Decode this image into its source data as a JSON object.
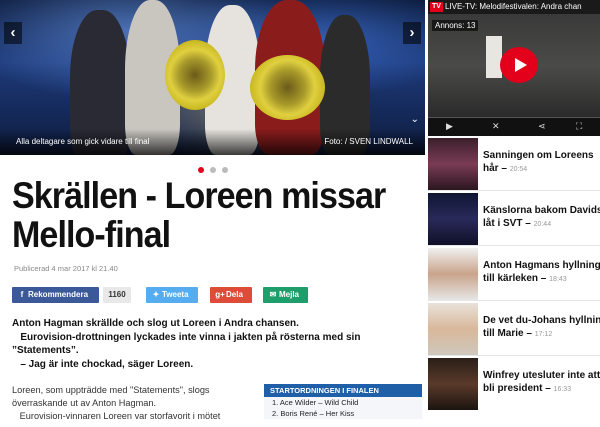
{
  "hero": {
    "caption": "Alla deltagare som gick vidare till final",
    "credit": "Foto: / SVEN LINDWALL",
    "prev": "‹",
    "next": "›",
    "expand": "⌄"
  },
  "article": {
    "headline": "Skrällen - Loreen missar Mello-final",
    "published": "Publicerad 4 mar 2017 kl 21.40",
    "share": {
      "facebook_label": "Rekommendera",
      "facebook_count": "1160",
      "twitter_label": "Tweeta",
      "gplus_label": "Dela",
      "email_label": "Mejla"
    },
    "lead": [
      "Anton Hagman skrällde och slog ut Loreen i Andra chansen.",
      "   Eurovision-drottningen lyckades inte vinna i jakten på rösterna med sin ”Statements”.",
      "   – Jag är inte chockad, säger Loreen."
    ],
    "body": [
      "Loreen, som uppträdde med \"Statements\", slogs överraskande ut av Anton Hagman.",
      "   Eurovision-vinnaren Loreen var storfavorit i mötet"
    ],
    "box": {
      "heading": "STARTORDNINGEN I FINALEN",
      "items": [
        "1. Ace Wilder – Wild Child",
        "2. Boris René – Her Kiss"
      ]
    }
  },
  "video": {
    "tv_badge": "TV",
    "title": "LIVE-TV: Melodifestivalen: Andra chan",
    "ad_label": "Annons: 13",
    "controls": [
      "▶",
      "✕",
      "⋖",
      "⛶"
    ]
  },
  "news": [
    {
      "title": "Sanningen om Loreens",
      "title2": "hår",
      "time": "20:54"
    },
    {
      "title": "Känslorna bakom Davids",
      "title2": "låt i SVT",
      "time": "20:44"
    },
    {
      "title": "Anton Hagmans hyllning",
      "title2": "till kärleken",
      "time": "18:43"
    },
    {
      "title": "De vet du-Johans hyllning",
      "title2": "till Marie",
      "time": "17:12"
    },
    {
      "title": "Winfrey utesluter inte att",
      "title2": "bli president",
      "time": "16:33"
    }
  ],
  "colors": {
    "accent": "#e2001a",
    "facebook": "#3b5998",
    "twitter": "#55acee",
    "gplus": "#dd4b39",
    "email": "#1e9e6a",
    "box_header": "#1f5fa8"
  }
}
